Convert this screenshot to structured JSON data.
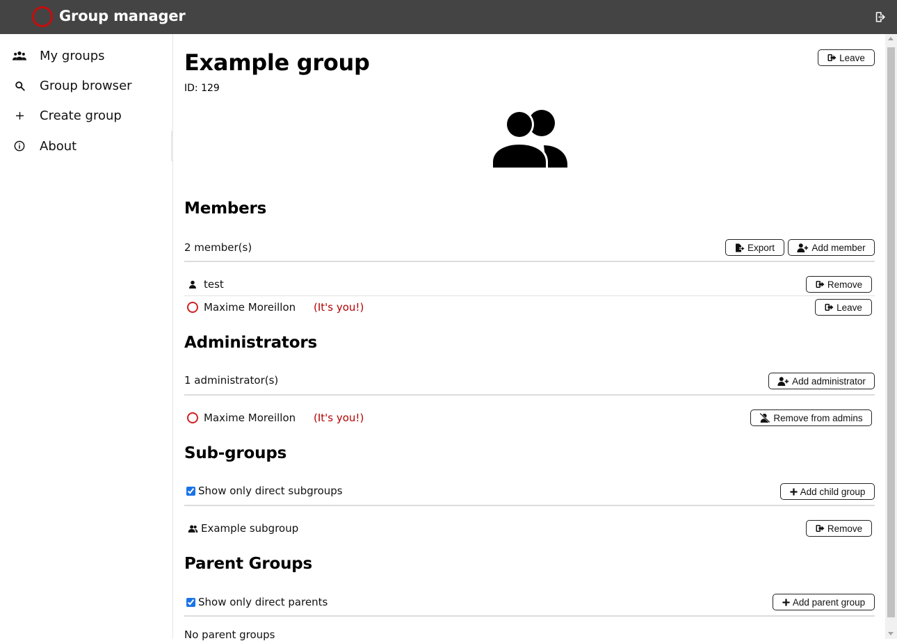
{
  "app": {
    "title": "Group manager",
    "brand_color": "#c40d0d",
    "header_bg": "#444444"
  },
  "header": {
    "logout_icon": "logout-icon"
  },
  "sidebar": {
    "items": [
      {
        "label": "My groups",
        "icon": "groups-icon"
      },
      {
        "label": "Group browser",
        "icon": "search-icon"
      },
      {
        "label": "Create group",
        "icon": "plus-icon"
      },
      {
        "label": "About",
        "icon": "info-icon"
      }
    ]
  },
  "group": {
    "title": "Example group",
    "id_text": "ID: 129",
    "leave_label": "Leave"
  },
  "members": {
    "heading": "Members",
    "count_text": "2 member(s)",
    "export_label": "Export",
    "add_label": "Add member",
    "rows": [
      {
        "name": "test",
        "action_label": "Remove"
      },
      {
        "name": "Maxime Moreillon",
        "you_tag": "(It's you!)",
        "action_label": "Leave"
      }
    ]
  },
  "administrators": {
    "heading": "Administrators",
    "count_text": "1 administrator(s)",
    "add_label": "Add administrator",
    "rows": [
      {
        "name": "Maxime Moreillon",
        "you_tag": "(It's you!)",
        "action_label": "Remove from admins"
      }
    ]
  },
  "subgroups": {
    "heading": "Sub-groups",
    "checkbox_label": "Show only direct subgroups",
    "checked": true,
    "add_label": "Add child group",
    "rows": [
      {
        "name": "Example subgroup",
        "action_label": "Remove"
      }
    ]
  },
  "parents": {
    "heading": "Parent Groups",
    "checkbox_label": "Show only direct parents",
    "checked": true,
    "add_label": "Add parent group",
    "empty_text": "No parent groups"
  }
}
